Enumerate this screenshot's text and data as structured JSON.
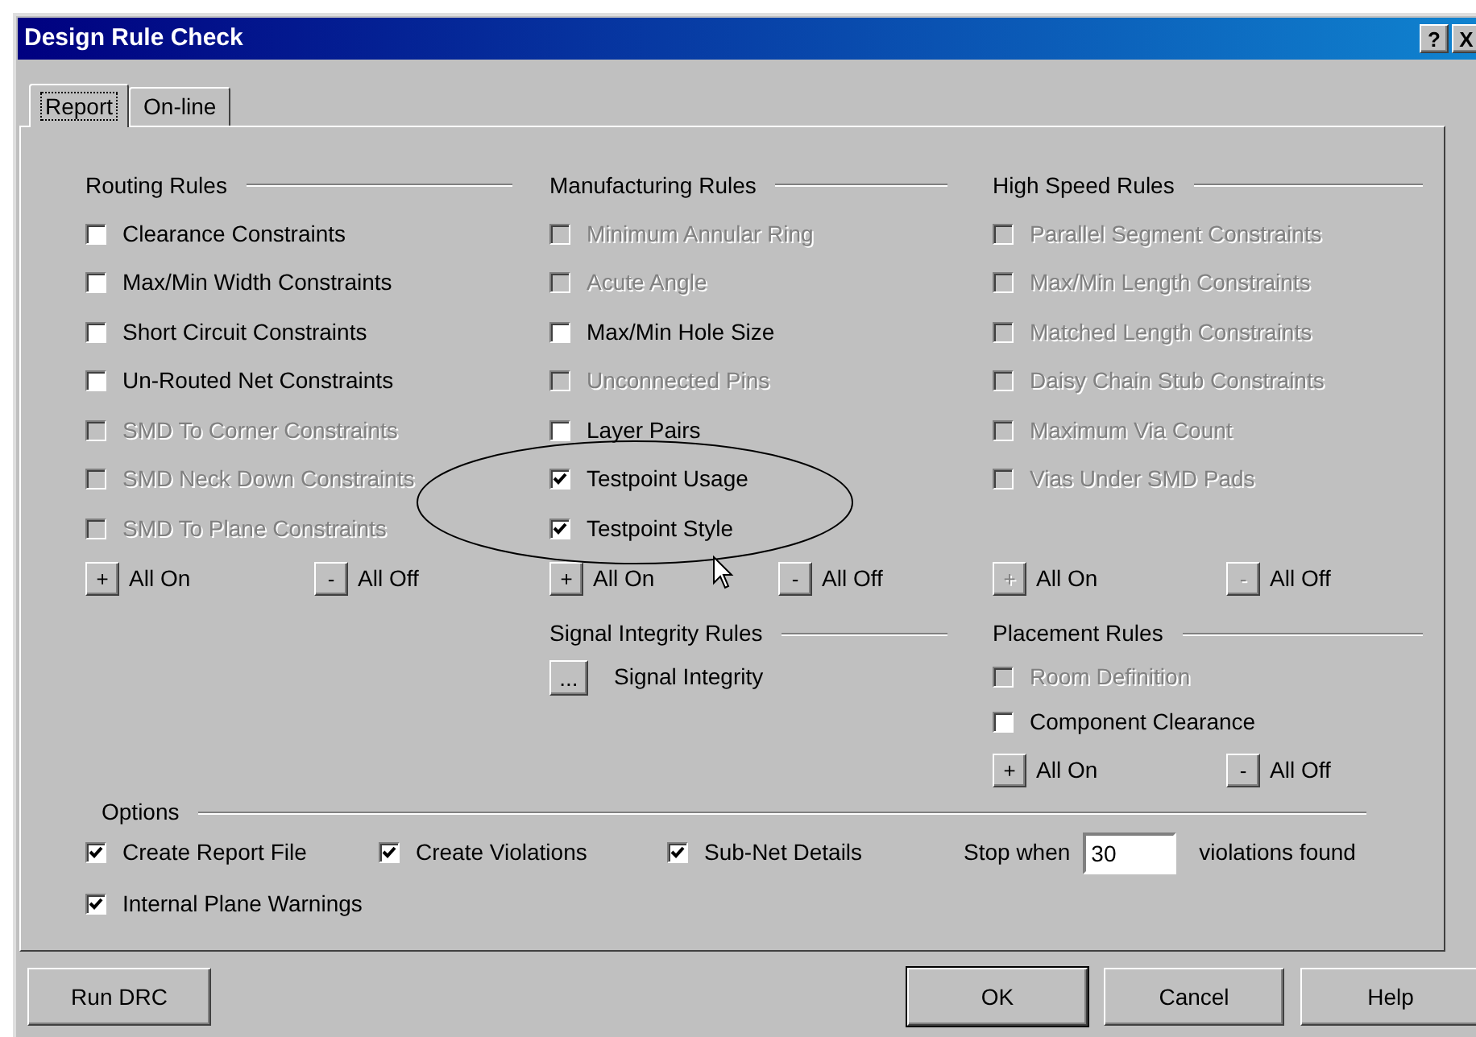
{
  "window": {
    "title": "Design Rule Check",
    "help_button": "?",
    "close_button": "X"
  },
  "tabs": [
    {
      "label": "Report",
      "selected": true
    },
    {
      "label": "On-line",
      "selected": false
    }
  ],
  "rule_groups": [
    {
      "title": "Routing Rules",
      "items": [
        {
          "label": "Clearance Constraints",
          "checked": false,
          "disabled": false
        },
        {
          "label": "Max/Min Width Constraints",
          "checked": false,
          "disabled": false
        },
        {
          "label": "Short Circuit Constraints",
          "checked": false,
          "disabled": false
        },
        {
          "label": "Un-Routed Net Constraints",
          "checked": false,
          "disabled": false
        },
        {
          "label": "SMD To Corner Constraints",
          "checked": false,
          "disabled": true
        },
        {
          "label": "SMD Neck Down Constraints",
          "checked": false,
          "disabled": true
        },
        {
          "label": "SMD To Plane Constraints",
          "checked": false,
          "disabled": true
        }
      ],
      "all_on": {
        "sign": "+",
        "label": "All On",
        "disabled": false
      },
      "all_off": {
        "sign": "-",
        "label": "All Off",
        "disabled": false
      }
    },
    {
      "title": "Manufacturing Rules",
      "items": [
        {
          "label": "Minimum Annular Ring",
          "checked": false,
          "disabled": true
        },
        {
          "label": "Acute Angle",
          "checked": false,
          "disabled": true
        },
        {
          "label": "Max/Min Hole Size",
          "checked": false,
          "disabled": false
        },
        {
          "label": "Unconnected Pins",
          "checked": false,
          "disabled": true
        },
        {
          "label": "Layer Pairs",
          "checked": false,
          "disabled": false
        },
        {
          "label": "Testpoint Usage",
          "checked": true,
          "disabled": false
        },
        {
          "label": "Testpoint Style",
          "checked": true,
          "disabled": false
        }
      ],
      "all_on": {
        "sign": "+",
        "label": "All On",
        "disabled": false
      },
      "all_off": {
        "sign": "-",
        "label": "All Off",
        "disabled": false
      }
    },
    {
      "title": "High Speed Rules",
      "items": [
        {
          "label": "Parallel Segment Constraints",
          "checked": false,
          "disabled": true
        },
        {
          "label": "Max/Min Length Constraints",
          "checked": false,
          "disabled": true
        },
        {
          "label": "Matched Length Constraints",
          "checked": false,
          "disabled": true
        },
        {
          "label": "Daisy Chain Stub Constraints",
          "checked": false,
          "disabled": true
        },
        {
          "label": "Maximum Via Count",
          "checked": false,
          "disabled": true
        },
        {
          "label": "Vias Under SMD Pads",
          "checked": false,
          "disabled": true
        }
      ],
      "all_on": {
        "sign": "+",
        "label": "All On",
        "disabled": true
      },
      "all_off": {
        "sign": "-",
        "label": "All Off",
        "disabled": true
      }
    }
  ],
  "signal_integrity": {
    "title": "Signal Integrity Rules",
    "button": "...",
    "label": "Signal Integrity"
  },
  "placement": {
    "title": "Placement Rules",
    "items": [
      {
        "label": "Room Definition",
        "checked": false,
        "disabled": true
      },
      {
        "label": "Component Clearance",
        "checked": false,
        "disabled": false
      }
    ],
    "all_on": {
      "sign": "+",
      "label": "All On",
      "disabled": false
    },
    "all_off": {
      "sign": "-",
      "label": "All Off",
      "disabled": false
    }
  },
  "options": {
    "title": "Options",
    "checkboxes": [
      {
        "label": "Create Report File",
        "checked": true
      },
      {
        "label": "Create Violations",
        "checked": true
      },
      {
        "label": "Sub-Net Details",
        "checked": true
      },
      {
        "label": "Internal Plane Warnings",
        "checked": true
      }
    ],
    "stop_when": {
      "label": "Stop when",
      "value": "30",
      "suffix": "violations found"
    }
  },
  "footer_buttons": [
    "Run DRC",
    "OK",
    "Cancel",
    "Help"
  ]
}
